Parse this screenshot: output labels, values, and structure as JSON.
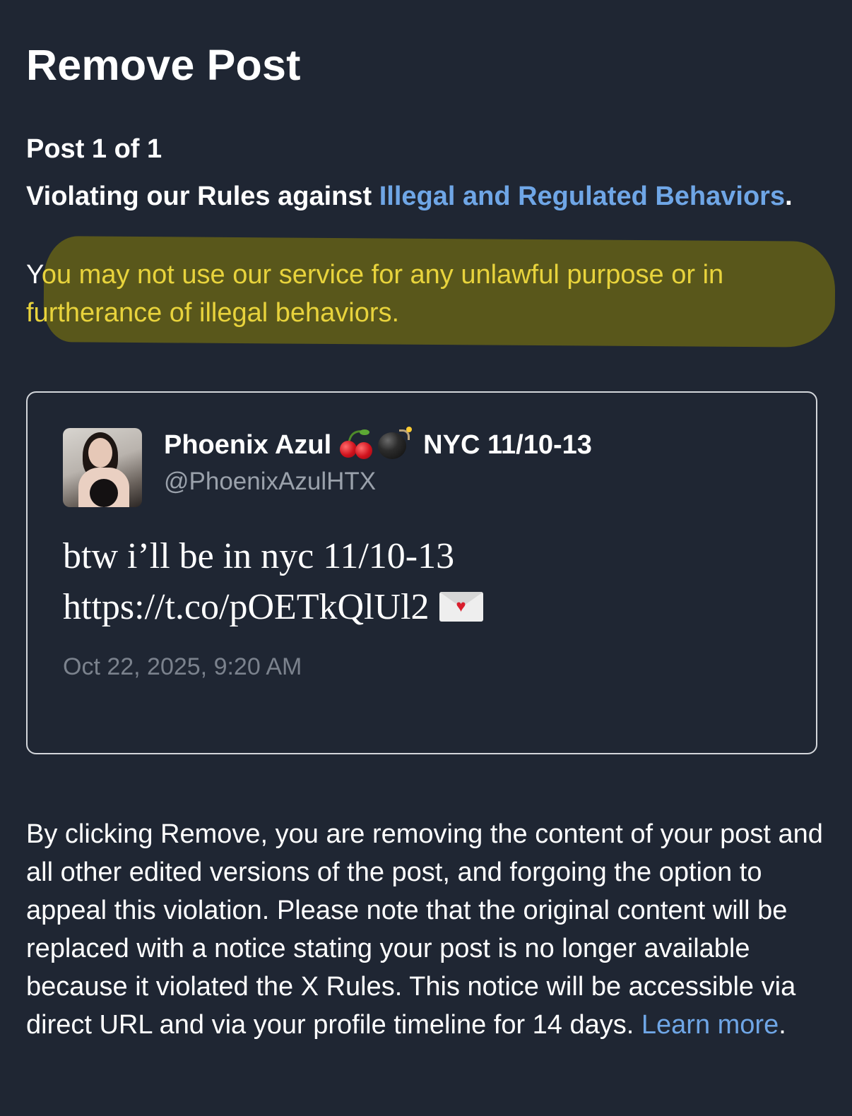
{
  "header": {
    "title": "Remove Post"
  },
  "violation": {
    "counter": "Post 1 of 1",
    "prefix": "Violating our Rules against ",
    "rule_link": "Illegal and Regulated Behaviors",
    "suffix": ".",
    "policy_first": "Y",
    "policy_rest": "ou may not use our service for any unlawful purpose or in furtherance of illegal behaviors.",
    "highlight_color": "#5f5d18"
  },
  "post": {
    "name_part1": "Phoenix Azul",
    "name_emojis": [
      "cherries-icon",
      "bomb-icon"
    ],
    "name_part2": "NYC 11/10-13",
    "handle": "@PhoenixAzulHTX",
    "text_line1": "btw i’ll be in nyc 11/10-13",
    "text_line2": "https://t.co/pOETkQlUl2",
    "text_emoji": "love-letter-icon",
    "date": "Oct 22, 2025, 9:20 AM"
  },
  "disclaimer": {
    "text": "By clicking Remove, you are removing the content of your post and all other edited versions of the post, and forgoing the option to appeal this violation. Please note that the original content will be replaced with a notice stating your post is no longer available because it violated the X Rules. This notice will be accessible via direct URL and via your profile timeline for 14 days. ",
    "learn_more": "Learn more",
    "end": "."
  },
  "colors": {
    "background": "#1f2633",
    "link": "#6fa6e6",
    "highlight_text": "#e8d33c",
    "muted": "#9aa1ab"
  }
}
